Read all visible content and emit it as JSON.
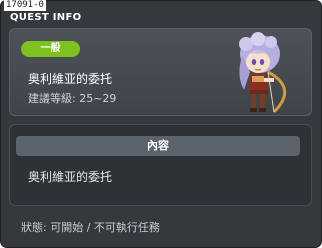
{
  "window": {
    "id_tag": "17091-0",
    "title": "QUEST INFO"
  },
  "quest": {
    "category": "一般",
    "name": "奥利維亚的委托",
    "level_requirement": "建議等級: 25~29"
  },
  "content": {
    "header": "內容",
    "text": "奥利維亚的委托"
  },
  "status": {
    "text": "狀態: 可開始 / 不可執行任務"
  },
  "colors": {
    "category_badge": "#7ec21f",
    "window_bg": "#35393e",
    "header_bg": "#5b646d"
  },
  "icons": {
    "portrait": "npc-olivia-portrait-icon"
  }
}
